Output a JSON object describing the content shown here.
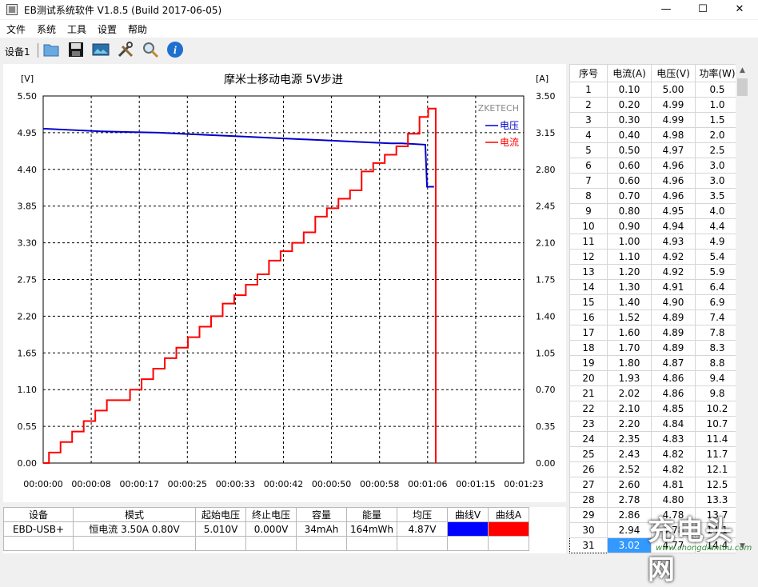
{
  "window": {
    "title": "EB测试系统软件 V1.8.5 (Build 2017-06-05)",
    "controls": {
      "minimize": "—",
      "maximize": "☐",
      "close": "✕"
    }
  },
  "menu": [
    "文件",
    "系统",
    "工具",
    "设置",
    "帮助"
  ],
  "toolbar": {
    "device_tab": "设备1",
    "buttons": [
      "folder-icon",
      "save-icon",
      "image-icon",
      "tools-icon",
      "magnifier-icon",
      "info-icon"
    ],
    "info_glyph": "i"
  },
  "chart_data": {
    "type": "line",
    "title": "摩米士移动电源 5V步进",
    "watermark": "ZKETECH",
    "left_unit": "[V]",
    "right_unit": "[A]",
    "x_ticks": [
      "00:00:00",
      "00:00:08",
      "00:00:17",
      "00:00:25",
      "00:00:33",
      "00:00:42",
      "00:00:50",
      "00:00:58",
      "00:01:06",
      "00:01:15",
      "00:01:23"
    ],
    "y_left_ticks": [
      "5.50",
      "4.95",
      "4.40",
      "3.85",
      "3.30",
      "2.75",
      "2.20",
      "1.65",
      "1.10",
      "0.55",
      "0.00"
    ],
    "y_right_ticks": [
      "3.50",
      "3.15",
      "2.80",
      "2.45",
      "2.10",
      "1.75",
      "1.40",
      "1.05",
      "0.70",
      "0.35",
      "0.00"
    ],
    "xlim": [
      0,
      83
    ],
    "y_left_lim": [
      0,
      5.5
    ],
    "y_right_lim": [
      0,
      3.5
    ],
    "grid": true,
    "legend_position": "top-right",
    "series": [
      {
        "name": "电压",
        "color": "#0000cc",
        "axis": "left",
        "x": [
          0,
          5,
          10,
          15,
          20,
          25,
          30,
          35,
          40,
          45,
          50,
          55,
          60,
          62,
          66,
          66.3,
          67.5
        ],
        "y": [
          5.01,
          4.99,
          4.97,
          4.96,
          4.95,
          4.93,
          4.91,
          4.89,
          4.87,
          4.85,
          4.83,
          4.81,
          4.79,
          4.79,
          4.77,
          4.14,
          4.14
        ]
      },
      {
        "name": "电流",
        "color": "#ff0000",
        "axis": "right",
        "x": [
          0,
          1,
          3,
          5,
          7,
          9,
          11,
          13,
          15,
          17,
          19,
          21,
          23,
          25,
          27,
          29,
          31,
          33,
          35,
          37,
          39,
          41,
          43,
          45,
          47,
          49,
          51,
          53,
          55,
          57,
          59,
          61,
          63,
          65,
          66.5,
          67.8,
          67.8
        ],
        "y": [
          0,
          0.1,
          0.2,
          0.3,
          0.4,
          0.5,
          0.6,
          0.6,
          0.7,
          0.8,
          0.9,
          1.0,
          1.1,
          1.2,
          1.3,
          1.4,
          1.52,
          1.6,
          1.7,
          1.8,
          1.93,
          2.02,
          2.1,
          2.2,
          2.35,
          2.43,
          2.52,
          2.6,
          2.78,
          2.86,
          2.94,
          3.02,
          3.14,
          3.3,
          3.38,
          3.38,
          0
        ]
      }
    ]
  },
  "data_table": {
    "headers": [
      "序号",
      "电流(A)",
      "电压(V)",
      "功率(W)"
    ],
    "rows": [
      [
        "1",
        "0.10",
        "5.00",
        "0.5"
      ],
      [
        "2",
        "0.20",
        "4.99",
        "1.0"
      ],
      [
        "3",
        "0.30",
        "4.99",
        "1.5"
      ],
      [
        "4",
        "0.40",
        "4.98",
        "2.0"
      ],
      [
        "5",
        "0.50",
        "4.97",
        "2.5"
      ],
      [
        "6",
        "0.60",
        "4.96",
        "3.0"
      ],
      [
        "7",
        "0.60",
        "4.96",
        "3.0"
      ],
      [
        "8",
        "0.70",
        "4.96",
        "3.5"
      ],
      [
        "9",
        "0.80",
        "4.95",
        "4.0"
      ],
      [
        "10",
        "0.90",
        "4.94",
        "4.4"
      ],
      [
        "11",
        "1.00",
        "4.93",
        "4.9"
      ],
      [
        "12",
        "1.10",
        "4.92",
        "5.4"
      ],
      [
        "13",
        "1.20",
        "4.92",
        "5.9"
      ],
      [
        "14",
        "1.30",
        "4.91",
        "6.4"
      ],
      [
        "15",
        "1.40",
        "4.90",
        "6.9"
      ],
      [
        "16",
        "1.52",
        "4.89",
        "7.4"
      ],
      [
        "17",
        "1.60",
        "4.89",
        "7.8"
      ],
      [
        "18",
        "1.70",
        "4.89",
        "8.3"
      ],
      [
        "19",
        "1.80",
        "4.87",
        "8.8"
      ],
      [
        "20",
        "1.93",
        "4.86",
        "9.4"
      ],
      [
        "21",
        "2.02",
        "4.86",
        "9.8"
      ],
      [
        "22",
        "2.10",
        "4.85",
        "10.2"
      ],
      [
        "23",
        "2.20",
        "4.84",
        "10.7"
      ],
      [
        "24",
        "2.35",
        "4.83",
        "11.4"
      ],
      [
        "25",
        "2.43",
        "4.82",
        "11.7"
      ],
      [
        "26",
        "2.52",
        "4.82",
        "12.1"
      ],
      [
        "27",
        "2.60",
        "4.81",
        "12.5"
      ],
      [
        "28",
        "2.78",
        "4.80",
        "13.3"
      ],
      [
        "29",
        "2.86",
        "4.78",
        "13.7"
      ],
      [
        "30",
        "2.94",
        "4.78",
        "14.1"
      ],
      [
        "31",
        "3.02",
        "4.77",
        "14.4"
      ]
    ],
    "selected_row": 31
  },
  "summary": {
    "headers": [
      "设备",
      "模式",
      "起始电压",
      "终止电压",
      "容量",
      "能量",
      "均压",
      "曲线V",
      "曲线A"
    ],
    "row": [
      "EBD-USB+",
      "恒电流  3.50A  0.80V",
      "5.010V",
      "0.000V",
      "34mAh",
      "164mWh",
      "4.87V"
    ],
    "curve_v_color": "#0000ff",
    "curve_a_color": "#ff0000"
  },
  "overlay": {
    "watermark_text": "充电头网",
    "watermark_url": "www.chongdiantou.com"
  }
}
